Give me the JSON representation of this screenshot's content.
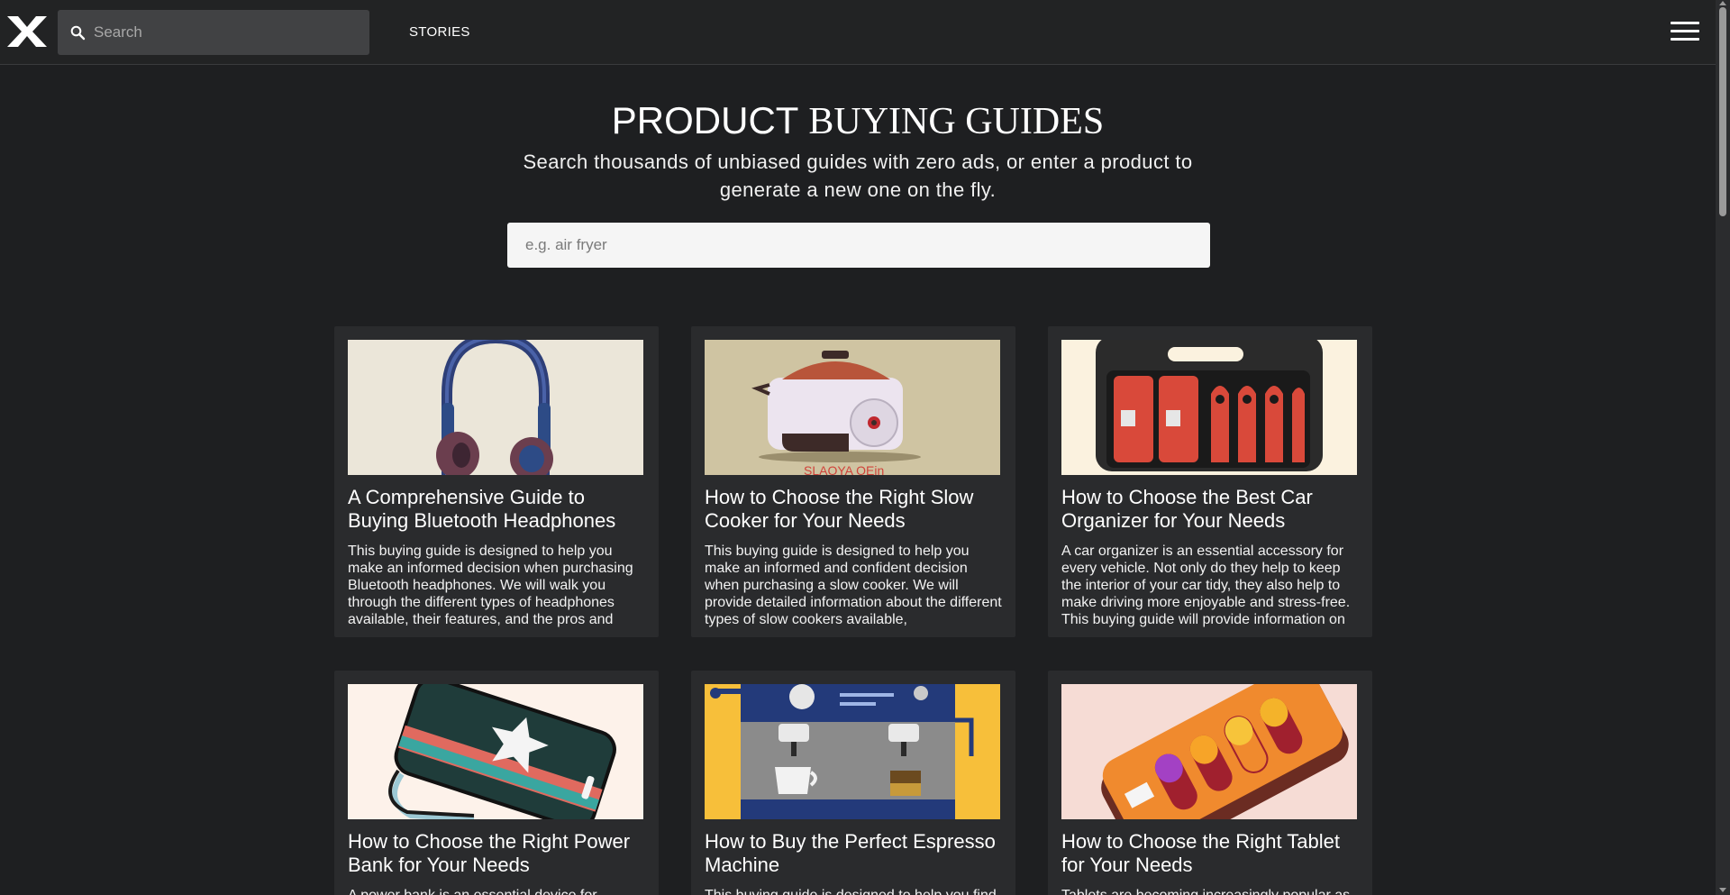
{
  "header": {
    "search_placeholder": "Search",
    "nav_stories": "STORIES"
  },
  "hero": {
    "title_part1": "PRODUCT",
    "title_part2": "BUYING GUIDES",
    "subtitle": "Search thousands of unbiased guides with zero ads, or enter a product to generate a new one on the fly.",
    "input_placeholder": "e.g. air fryer"
  },
  "cards": [
    {
      "title": "A Comprehensive Guide to Buying Bluetooth Headphones",
      "description": "This buying guide is designed to help you make an informed decision when purchasing Bluetooth headphones. We will walk you through the different types of headphones available, their features, and the pros and",
      "image": "headphones-illustration"
    },
    {
      "title": "How to Choose the Right Slow Cooker for Your Needs",
      "description": "This buying guide is designed to help you make an informed and confident decision when purchasing a slow cooker. We will provide detailed information about the different types of slow cookers available,",
      "image": "slow-cooker-illustration"
    },
    {
      "title": "How to Choose the Best Car Organizer for Your Needs",
      "description": "A car organizer is an essential accessory for every vehicle. Not only do they help to keep the interior of your car tidy, they also help to make driving more enjoyable and stress-free. This buying guide will provide information on",
      "image": "car-organizer-illustration"
    },
    {
      "title": "How to Choose the Right Power Bank for Your Needs",
      "description": "A power bank is an essential device for",
      "image": "power-bank-illustration"
    },
    {
      "title": "How to Buy the Perfect Espresso Machine",
      "description": "This buying guide is designed to help you find",
      "image": "espresso-machine-illustration"
    },
    {
      "title": "How to Choose the Right Tablet for Your Needs",
      "description": "Tablets are becoming increasingly popular as",
      "image": "tablet-illustration"
    }
  ],
  "colors": {
    "background": "#1e1f21",
    "header": "#222324",
    "card": "#2a2b2d",
    "search_field": "#414244",
    "hero_input": "#f5f5f5"
  },
  "icons": {
    "logo": "x-logo-icon",
    "search": "search-icon",
    "menu": "hamburger-menu-icon"
  }
}
